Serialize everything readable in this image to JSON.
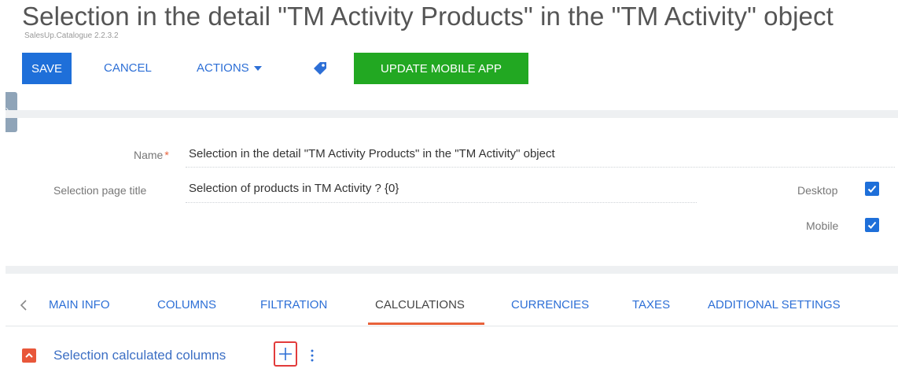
{
  "header": {
    "title": "Selection in the detail \"TM Activity Products\" in the \"TM Activity\" object",
    "package": "SalesUp.Catalogue 2.2.3.2"
  },
  "toolbar": {
    "save_label": "SAVE",
    "cancel_label": "CANCEL",
    "actions_label": "ACTIONS",
    "update_label": "UPDATE MOBILE APP"
  },
  "form": {
    "name_label": "Name",
    "name_required_mark": "*",
    "name_value": "Selection in the detail \"TM Activity Products\" in the \"TM Activity\" object",
    "page_title_label": "Selection page title",
    "page_title_value": "Selection of products in TM Activity ? {0}",
    "desktop_label": "Desktop",
    "desktop_checked": true,
    "mobile_label": "Mobile",
    "mobile_checked": true
  },
  "tabs": {
    "items": [
      {
        "label": "MAIN INFO"
      },
      {
        "label": "COLUMNS"
      },
      {
        "label": "FILTRATION"
      },
      {
        "label": "CALCULATIONS"
      },
      {
        "label": "CURRENCIES"
      },
      {
        "label": "TAXES"
      },
      {
        "label": "ADDITIONAL SETTINGS"
      }
    ],
    "active": "CALCULATIONS"
  },
  "detail": {
    "title": "Selection calculated columns"
  },
  "colors": {
    "primary": "#1e6fd9",
    "success": "#22a822",
    "accent": "#e8623b",
    "link": "#2d6fd6"
  }
}
